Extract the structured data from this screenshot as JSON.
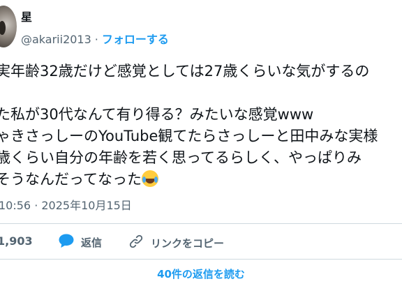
{
  "author": {
    "display_name": "星",
    "handle": "@akarii2013",
    "separator": "·",
    "follow_label": "フォローする"
  },
  "tweet": {
    "lines": [
      "実年齢32歳だけど感覚としては27歳くらいな気がするの",
      "",
      "た私が30代なんて有り得る？みたいな感覚www",
      "ゃきさっしーのYouTube観てたらさっしーと田中みな実様",
      "歳くらい自分の年齢を若く思ってるらしく、やっぱりみ",
      "そうなんだってなった"
    ],
    "emoji": "face-with-tears-of-joy",
    "timestamp": "10:56 · 2025年10月15日"
  },
  "actions": {
    "like_count": "1,903",
    "reply_label": "返信",
    "copy_link_label": "リンクをコピー"
  },
  "read_replies_label": "40件の返信を読む",
  "colors": {
    "accent": "#1d9bf0",
    "text": "#0f1419",
    "muted": "#536471",
    "border": "#cfd9de"
  }
}
